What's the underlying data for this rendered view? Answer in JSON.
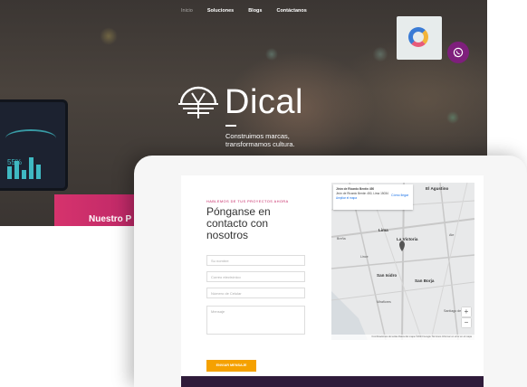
{
  "nav": {
    "items": [
      "Inicio",
      "Soluciones",
      "Blogs",
      "Contáctanos"
    ]
  },
  "hero": {
    "brand": "Dical",
    "tagline_line1": "Construimos marcas,",
    "tagline_line2": "transformamos cultura.",
    "promo_label": "Nuestro P",
    "monitor_text": "55%"
  },
  "contact": {
    "kicker": "HABLEMOS DE TUS PROYECTOS AHORA",
    "heading_line1": "Pónganse en",
    "heading_line2": "contacto con",
    "heading_line3": "nosotros",
    "fields": {
      "name": "Su nombre",
      "email": "Correo electrónico",
      "phone": "Número de Celular",
      "message": "Mensaje"
    },
    "submit_label": "ENVIAR MENSAJE"
  },
  "map": {
    "info_title": "Jirón de Ricardo Bentín 450",
    "info_address": "Jirón de Ricardo Bentín 450, Lima 15034",
    "info_link": "Ampliar el mapa",
    "directions": "Cómo llegar",
    "places": [
      "El Agustino",
      "Lima",
      "La Victoria",
      "San Isidro",
      "Miraflores",
      "San Borja",
      "Lince",
      "Santiago de Surco",
      "Breña",
      "Ate"
    ],
    "footer": "Combinaciones de teclas  Datos del mapa ©2023 Google  Términos  Informar un error en el mapa"
  },
  "colors": {
    "accent_magenta": "#c2185b",
    "button_orange": "#f5a100",
    "whatsapp_purple": "#7e1f7c"
  }
}
